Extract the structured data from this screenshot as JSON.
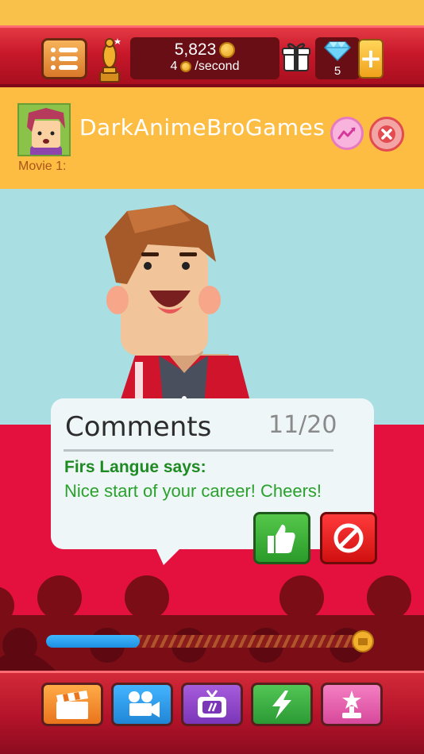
{
  "header": {
    "money_total": "5,823",
    "money_rate_amount": "4",
    "money_rate_unit": "/second",
    "gems": "5",
    "plus": "+"
  },
  "player": {
    "name": "DarkAnimeBroGames",
    "movie_label": "Movie 1:"
  },
  "comments": {
    "title": "Comments",
    "counter": "11/20",
    "author": "Firs Langue says:",
    "text": "Nice start  of your career! Cheers!"
  },
  "progress": {
    "fraction": 0.3
  },
  "bottom_nav": [
    {
      "icon": "clapperboard-icon",
      "color": "#f08a24"
    },
    {
      "icon": "movie-camera-icon",
      "color": "#2f9ae8"
    },
    {
      "icon": "tv-icon",
      "color": "#8e44c9"
    },
    {
      "icon": "lightning-icon",
      "color": "#3cb54a"
    },
    {
      "icon": "star-trophy-icon",
      "color": "#e35aa6"
    }
  ],
  "colors": {
    "top_bar": "#c8182a",
    "player_bar": "#fdbd42",
    "sky": "#a9dfe3",
    "stage": "#e4113f",
    "comment_green": "#1e8b22"
  }
}
